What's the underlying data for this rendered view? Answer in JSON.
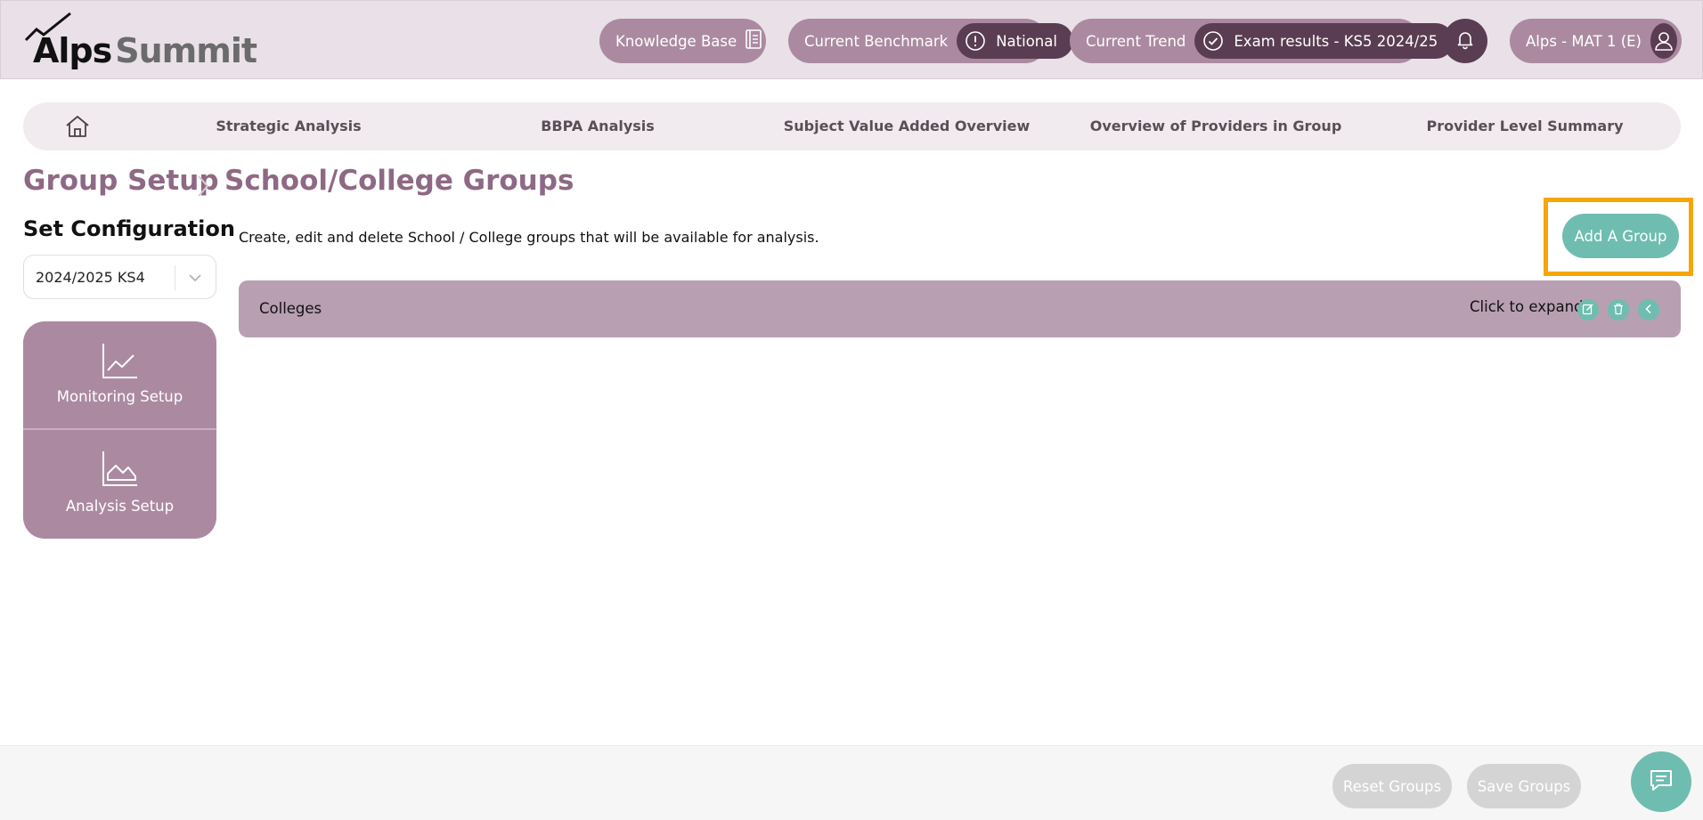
{
  "app": {
    "logo_alps": "Alps",
    "logo_summit": "Summit"
  },
  "header": {
    "knowledge_base": "Knowledge Base",
    "benchmark_label": "Current Benchmark",
    "benchmark_value": "National",
    "trend_label": "Current Trend",
    "trend_value": "Exam results - KS5 2024/25",
    "user_label": "Alps - MAT 1 (E)"
  },
  "nav": {
    "items": [
      {
        "label": "Strategic Analysis"
      },
      {
        "label": "BBPA Analysis"
      },
      {
        "label": "Subject Value Added Overview"
      },
      {
        "label": "Overview of Providers in Group"
      },
      {
        "label": "Provider Level Summary"
      }
    ]
  },
  "breadcrumb": {
    "parent": "Group Setup",
    "current": "School/College Groups"
  },
  "sidebar": {
    "title": "Set Configuration",
    "config_select_value": "2024/2025 KS4",
    "items": [
      {
        "label": "Monitoring Setup",
        "icon": "line-chart-icon"
      },
      {
        "label": "Analysis Setup",
        "icon": "area-chart-icon"
      }
    ]
  },
  "main": {
    "description": "Create, edit and delete School / College groups that will be available for analysis.",
    "add_button": "Add A Group",
    "groups": [
      {
        "name": "Colleges",
        "expand_hint": "Click to expand"
      }
    ]
  },
  "footer": {
    "reset_button": "Reset Groups",
    "save_button": "Save Groups"
  },
  "colors": {
    "header_bg": "#e9e1e7",
    "pill": "#ab8aa1",
    "pill_dark": "#5a3d52",
    "accent_teal": "#6fbdb0",
    "heading_mauve": "#8e6985",
    "highlight": "#f7a600",
    "disabled": "#d4d4d4"
  }
}
